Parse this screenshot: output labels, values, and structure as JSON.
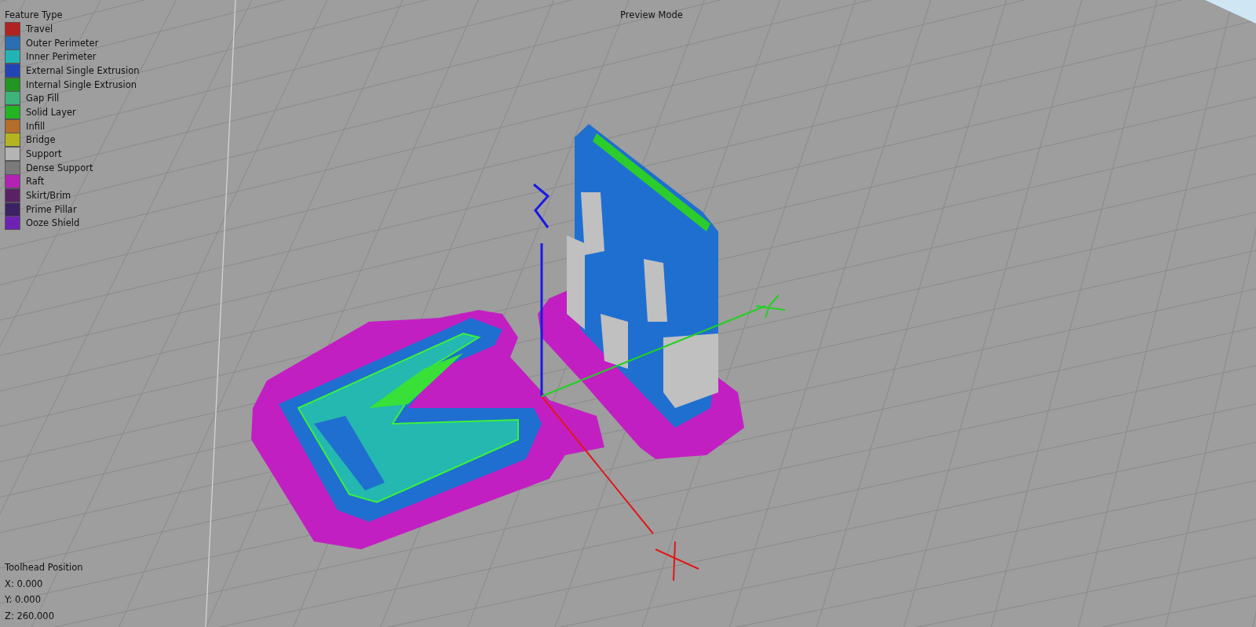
{
  "legend": {
    "title": "Feature Type",
    "items": [
      {
        "label": "Travel",
        "color": "#b22222"
      },
      {
        "label": "Outer Perimeter",
        "color": "#2a6eb4"
      },
      {
        "label": "Inner Perimeter",
        "color": "#22b4b4"
      },
      {
        "label": "External Single Extrusion",
        "color": "#2244b4"
      },
      {
        "label": "Internal Single Extrusion",
        "color": "#229622"
      },
      {
        "label": "Gap Fill",
        "color": "#3cb47a"
      },
      {
        "label": "Solid Layer",
        "color": "#22b422"
      },
      {
        "label": "Infill",
        "color": "#b46e2a"
      },
      {
        "label": "Bridge",
        "color": "#b4b422"
      },
      {
        "label": "Support",
        "color": "#b4b4b4"
      },
      {
        "label": "Dense Support",
        "color": "#7a7a7a"
      },
      {
        "label": "Raft",
        "color": "#b422b4"
      },
      {
        "label": "Skirt/Brim",
        "color": "#5a2264"
      },
      {
        "label": "Prime Pillar",
        "color": "#3c2264"
      },
      {
        "label": "Ooze Shield",
        "color": "#6e22b4"
      }
    ]
  },
  "mode": "Preview Mode",
  "toolhead": {
    "title": "Toolhead Position",
    "lines": [
      "X: 0.000",
      "Y: 0.000",
      "Z: 260.000"
    ]
  }
}
